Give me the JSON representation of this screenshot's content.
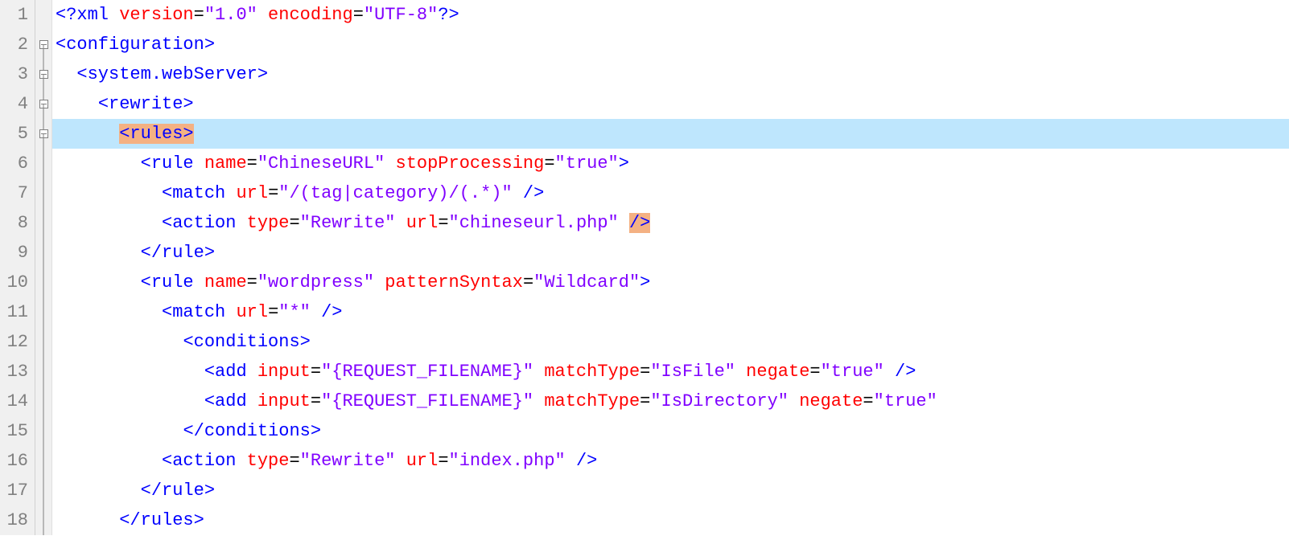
{
  "editor": {
    "activeLine": 5,
    "lineNumbers": [
      1,
      2,
      3,
      4,
      5,
      6,
      7,
      8,
      9,
      10,
      11,
      12,
      13,
      14,
      15,
      16,
      17,
      18
    ],
    "fold": {
      "2": "box-start",
      "3": "box",
      "4": "box",
      "5": "box",
      "6": "line",
      "7": "line",
      "8": "line",
      "9": "line",
      "10": "line",
      "11": "line",
      "12": "line",
      "13": "line",
      "14": "line",
      "15": "line",
      "16": "line",
      "17": "line",
      "18": "line"
    },
    "lines": {
      "l1": {
        "t1": "<?xml",
        "t2": " version",
        "t3": "=",
        "t4": "\"1.0\"",
        "t5": " encoding",
        "t6": "=",
        "t7": "\"UTF-8\"",
        "t8": "?>"
      },
      "l2": {
        "t1": "<configuration>"
      },
      "l3": {
        "indent": "  ",
        "t1": "<system.webServer>"
      },
      "l4": {
        "indent": "    ",
        "t1": "<rewrite>"
      },
      "l5": {
        "indent": "      ",
        "pre": "<rule",
        "post": "s>"
      },
      "l6": {
        "indent": "        ",
        "t1": "<rule",
        "t2": " name",
        "t3": "=",
        "t4": "\"ChineseURL\"",
        "t5": " stopProcessing",
        "t6": "=",
        "t7": "\"true\"",
        "t8": ">"
      },
      "l7": {
        "indent": "          ",
        "t1": "<match",
        "t2": " url",
        "t3": "=",
        "t4": "\"/(tag|category)/(.*)\"",
        "t5": " />"
      },
      "l8": {
        "indent": "          ",
        "t1": "<action",
        "t2": " type",
        "t3": "=",
        "t4": "\"Rewrite\"",
        "t5": " url",
        "t6": "=",
        "t7": "\"chineseurl.php\"",
        "t8": " ",
        "t9": "/>"
      },
      "l9": {
        "indent": "        ",
        "t1": "</rule>"
      },
      "l10": {
        "indent": "        ",
        "t1": "<rule",
        "t2": " name",
        "t3": "=",
        "t4": "\"wordpress\"",
        "t5": " patternSyntax",
        "t6": "=",
        "t7": "\"Wildcard\"",
        "t8": ">"
      },
      "l11": {
        "indent": "          ",
        "t1": "<match",
        "t2": " url",
        "t3": "=",
        "t4": "\"*\"",
        "t5": " />"
      },
      "l12": {
        "indent": "            ",
        "t1": "<conditions>"
      },
      "l13": {
        "indent": "              ",
        "t1": "<add",
        "t2": " input",
        "t3": "=",
        "t4": "\"{REQUEST_FILENAME}\"",
        "t5": " matchType",
        "t6": "=",
        "t7": "\"IsFile\"",
        "t8": " negate",
        "t9": "=",
        "t10": "\"true\"",
        "t11": " />"
      },
      "l14": {
        "indent": "              ",
        "t1": "<add",
        "t2": " input",
        "t3": "=",
        "t4": "\"{REQUEST_FILENAME}\"",
        "t5": " matchType",
        "t6": "=",
        "t7": "\"IsDirectory\"",
        "t8": " negate",
        "t9": "=",
        "t10": "\"true\"",
        "t11": ""
      },
      "l15": {
        "indent": "            ",
        "t1": "</conditions>"
      },
      "l16": {
        "indent": "          ",
        "t1": "<action",
        "t2": " type",
        "t3": "=",
        "t4": "\"Rewrite\"",
        "t5": " url",
        "t6": "=",
        "t7": "\"index.php\"",
        "t8": " />"
      },
      "l17": {
        "indent": "        ",
        "t1": "</rule>"
      },
      "l18": {
        "indent": "      ",
        "t1": "</rules>"
      }
    }
  }
}
